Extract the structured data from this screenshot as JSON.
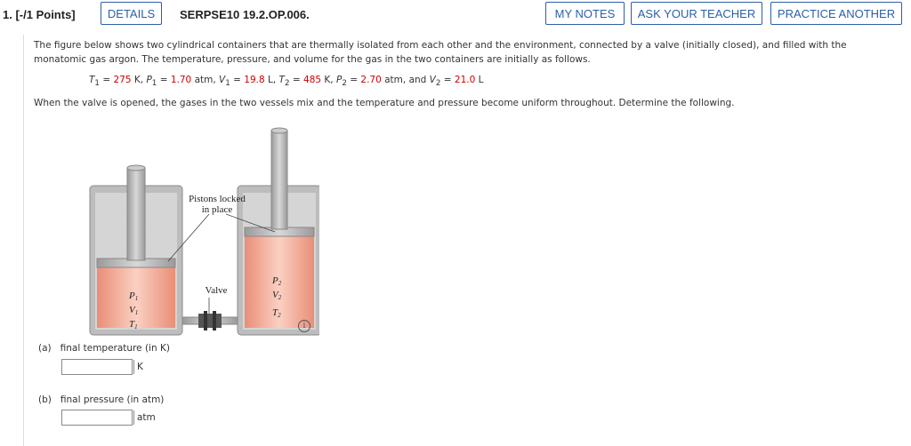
{
  "header": {
    "question_number": "1.",
    "points": "[-/1 Points]",
    "details_label": "DETAILS",
    "problem_code": "SERPSE10 19.2.OP.006.",
    "my_notes_label": "MY NOTES",
    "ask_teacher_label": "ASK YOUR TEACHER",
    "practice_another_label": "PRACTICE ANOTHER"
  },
  "problem": {
    "intro": "The figure below shows two cylindrical containers that are thermally isolated from each other and the environment, connected by a valve (initially closed), and filled with the monatomic gas argon. The temperature, pressure, and volume for the gas in the two containers are initially as follows.",
    "T1": "275",
    "P1": "1.70",
    "V1": "19.8",
    "T2": "485",
    "P2": "2.70",
    "V2": "21.0",
    "instruction": "When the valve is opened, the gases in the two vessels mix and the temperature and pressure become uniform throughout. Determine the following."
  },
  "figure": {
    "pistons_label_line1": "Pistons locked",
    "pistons_label_line2": "in place",
    "valve_label": "Valve",
    "left_labels": [
      "P",
      "V",
      "T"
    ],
    "right_labels": [
      "P",
      "V",
      "T"
    ],
    "left_sub": "1",
    "right_sub": "2",
    "colors": {
      "gas": "#f2a48f",
      "gas_light": "#fbd3c6",
      "metal": "#b9b9b9",
      "metal_dark": "#8a8a8a"
    }
  },
  "questions": [
    {
      "label": "(a)",
      "text": "final temperature (in K)",
      "unit": "K",
      "value": ""
    },
    {
      "label": "(b)",
      "text": "final pressure (in atm)",
      "unit": "atm",
      "value": ""
    }
  ]
}
